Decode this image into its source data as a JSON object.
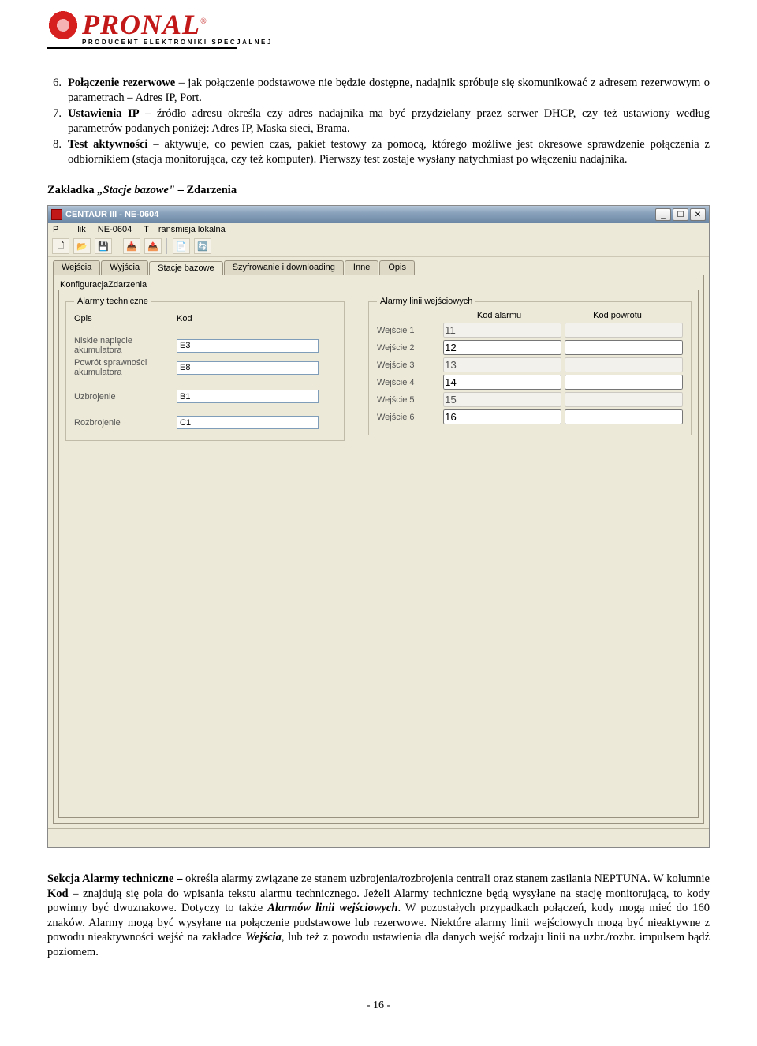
{
  "logo": {
    "brand": "PRONAL",
    "reg": "®",
    "sub": "PRODUCENT ELEKTRONIKI SPECJALNEJ"
  },
  "list": {
    "n6": "6.",
    "p6a": "Połączenie rezerwowe",
    "p6b": " – jak połączenie podstawowe nie będzie dostępne, nadajnik spróbuje się skomunikować z adresem rezerwowym o parametrach – Adres IP, Port.",
    "n7": "7.",
    "p7a": "Ustawienia IP",
    "p7b": " – źródło adresu określa czy adres nadajnika ma być przydzielany przez serwer DHCP, czy też ustawiony według parametrów podanych poniżej: Adres IP, Maska sieci, Brama.",
    "n8": "8.",
    "p8a": "Test aktywności",
    "p8b": " – aktywuje, co pewien czas, pakiet testowy za pomocą, którego możliwe jest okresowe sprawdzenie połączenia z odbiornikiem (stacja monitorująca, czy też komputer). Pierwszy test zostaje wysłany natychmiast po włączeniu nadajnika."
  },
  "sectHeading": {
    "a": "Zakładka ",
    "b": "„Stacje bazowe\"",
    "c": " – Zdarzenia"
  },
  "win": {
    "title": "CENTAUR III  -  NE-0604",
    "menu": {
      "plik": "Plik",
      "ne": "NE-0604",
      "trans": "Transmisja lokalna"
    },
    "tabs": {
      "wejscia": "Wejścia",
      "wyjscia": "Wyjścia",
      "stacje": "Stacje bazowe",
      "szyfr": "Szyfrowanie i downloading",
      "inne": "Inne",
      "opis": "Opis"
    },
    "subtabs": {
      "konf": "Konfiguracja",
      "zdar": "Zdarzenia"
    },
    "grpLeft": "Alarmy techniczne",
    "grpRight": "Alarmy linii wejściowych",
    "colOpis": "Opis",
    "colKod": "Kod",
    "colKodAlarmu": "Kod alarmu",
    "colKodPowrotu": "Kod powrotu",
    "rows": {
      "niskie": {
        "label": "Niskie napięcie akumulatora",
        "val": "E3"
      },
      "powrot": {
        "label": "Powrót sprawności akumulatora",
        "val": "E8"
      },
      "uzbr": {
        "label": "Uzbrojenie",
        "val": "B1"
      },
      "rozbr": {
        "label": "Rozbrojenie",
        "val": "C1"
      }
    },
    "we": {
      "w1": {
        "label": "Wejście 1",
        "kod": "11"
      },
      "w2": {
        "label": "Wejście 2",
        "kod": "12"
      },
      "w3": {
        "label": "Wejście 3",
        "kod": "13"
      },
      "w4": {
        "label": "Wejście 4",
        "kod": "14"
      },
      "w5": {
        "label": "Wejście 5",
        "kod": "15"
      },
      "w6": {
        "label": "Wejście 6",
        "kod": "16"
      }
    }
  },
  "tb": {
    "new": "🗋",
    "open": "📂",
    "save": "💾",
    "in": "📥",
    "out": "📤",
    "p": "📄",
    "r": "🔄"
  },
  "lower": {
    "p1": "Sekcja Alarmy techniczne – ",
    "p2": "określa alarmy związane ze stanem uzbrojenia/rozbrojenia centrali oraz stanem zasilania NEPTUNA. W kolumnie ",
    "p3": "Kod",
    "p4": " – znajdują się pola do wpisania tekstu alarmu technicznego. Jeżeli Alarmy techniczne będą wysyłane na stację monitorującą, to kody powinny być dwuznakowe. Dotyczy to także ",
    "p5": "Alarmów linii wejściowych",
    "p6": ". W pozostałych przypadkach połączeń, kody mogą mieć do 160 znaków. Alarmy mogą być wysyłane na połączenie podstawowe lub rezerwowe. Niektóre alarmy linii wejściowych mogą być nieaktywne z powodu nieaktywności wejść na zakładce ",
    "p7": "Wejścia",
    "p8": ", lub też z powodu ustawienia dla danych wejść rodzaju linii na uzbr./rozbr. impulsem bądź poziomem."
  },
  "footer": "- 16 -"
}
